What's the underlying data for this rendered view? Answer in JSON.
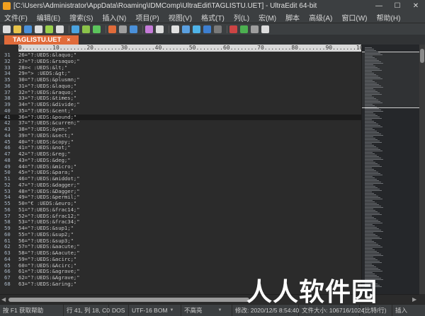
{
  "window": {
    "title": "[C:\\Users\\Administrator\\AppData\\Roaming\\IDMComp\\UltraEdit\\TAGLISTU.UET] - UltraEdit 64-bit",
    "minimize": "—",
    "maximize": "☐",
    "close": "✕"
  },
  "menu": {
    "items": [
      "文件(F)",
      "编辑(E)",
      "搜索(S)",
      "插入(N)",
      "项目(P)",
      "视图(V)",
      "格式(T)",
      "列(L)",
      "宏(M)",
      "脚本",
      "高级(A)",
      "窗口(W)",
      "帮助(H)"
    ]
  },
  "toolbar": {
    "icon_colors": [
      "#dcdcdc",
      "#e8c34a",
      "#4a90d9",
      "#dcdcdc",
      "#9ad14b",
      "#dcdcdc",
      "#4aa3df",
      "#8bc34a",
      "#5cc45c",
      "#e06b3a",
      "#9e9e9e",
      "#4a90d9",
      "#c57bd9",
      "#dcdcdc",
      "#e0e0e0",
      "#5aa0e0",
      "#4fb3e8",
      "#3d7fd0",
      "#7a7a7a",
      "#c44",
      "#4caf50",
      "#9e9e9e",
      "#dcdcdc"
    ]
  },
  "tab": {
    "label": "TAGLISTU.UET",
    "close": "×"
  },
  "editor": {
    "ruler": "0.........10........20........30........40........50........60........70........80........90.......100.......110....",
    "current_line_index": 10,
    "lines": [
      {
        "num": "31",
        "text": "26=\"?:UEDS:&laquo;\""
      },
      {
        "num": "32",
        "text": "27=\"?:UEDS:&rsaquo;\""
      },
      {
        "num": "33",
        "text": "28=< :UEDS:&lt;\""
      },
      {
        "num": "34",
        "text": "29=\"> :UEDS:&gt;\""
      },
      {
        "num": "35",
        "text": "30=\"?:UEDS:&plusmn;\""
      },
      {
        "num": "36",
        "text": "31=\"?:UEDS:&laquo;\""
      },
      {
        "num": "37",
        "text": "32=\"?:UEDS:&raquo;\""
      },
      {
        "num": "38",
        "text": "33=\"?:UEDS:&times;\""
      },
      {
        "num": "39",
        "text": "34=\"?:UEDS:&divide;\""
      },
      {
        "num": "40",
        "text": "35=\"?:UEDS:&cent;\""
      },
      {
        "num": "41",
        "text": "36=\"?:UEDS:&pound;\""
      },
      {
        "num": "42",
        "text": "37=\"?:UEDS:&curren;\""
      },
      {
        "num": "43",
        "text": "38=\"?:UEDS:&yen;\""
      },
      {
        "num": "44",
        "text": "39=\"?:UEDS:&sect;\""
      },
      {
        "num": "45",
        "text": "40=\"?:UEDS:&copy;\""
      },
      {
        "num": "46",
        "text": "41=\"?:UEDS:&not;\""
      },
      {
        "num": "47",
        "text": "42=\"?:UEDS:&reg;\""
      },
      {
        "num": "48",
        "text": "43=\"?:UEDS:&deg;\""
      },
      {
        "num": "49",
        "text": "44=\"?:UEDS:&micro;\""
      },
      {
        "num": "50",
        "text": "45=\"?:UEDS:&para;\""
      },
      {
        "num": "51",
        "text": "46=\"?:UEDS:&middot;\""
      },
      {
        "num": "52",
        "text": "47=\"?:UEDS:&dagger;\""
      },
      {
        "num": "53",
        "text": "48=\"?:UEDS:&Dagger;\""
      },
      {
        "num": "54",
        "text": "49=\"?:UEDS:&permil;\""
      },
      {
        "num": "55",
        "text": "50=\"€ :UEDS:&euro;\""
      },
      {
        "num": "56",
        "text": "51=\"?:UEDS:&frac14;\""
      },
      {
        "num": "57",
        "text": "52=\"?:UEDS:&frac12;\""
      },
      {
        "num": "58",
        "text": "53=\"?:UEDS:&frac34;\""
      },
      {
        "num": "59",
        "text": "54=\"?:UEDS:&sup1;\""
      },
      {
        "num": "60",
        "text": "55=\"?:UEDS:&sup2;\""
      },
      {
        "num": "61",
        "text": "56=\"?:UEDS:&sup3;\""
      },
      {
        "num": "62",
        "text": "57=\"?:UEDS:&aacute;\""
      },
      {
        "num": "63",
        "text": "58=\"?:UEDS:&Aacute;\""
      },
      {
        "num": "64",
        "text": "59=\"?:UEDS:&acirc;\""
      },
      {
        "num": "65",
        "text": "60=\"?:UEDS:&Acirc;\""
      },
      {
        "num": "66",
        "text": "61=\"?:UEDS:&agrave;\""
      },
      {
        "num": "67",
        "text": "62=\"?:UEDS:&Agrave;\""
      },
      {
        "num": "68",
        "text": "63=\"?:UEDS:&aring;\""
      }
    ]
  },
  "status": {
    "help": "按 F1 获取帮助",
    "position": "行 41, 列 18, C0",
    "line_ending": "DOS",
    "encoding": "UTF-16 BOM",
    "highlight": "不高亮",
    "modified": "修改: 2020/12/5 8:54:40",
    "filesize": "文件大小: 106716/1024",
    "readonly": "(比特/行)",
    "insert_mode": "插入"
  },
  "watermark": "人人软件园"
}
